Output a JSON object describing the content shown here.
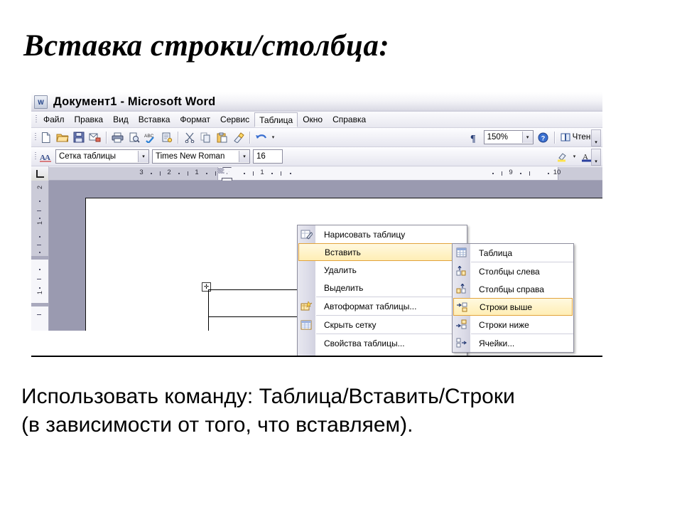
{
  "slide": {
    "title": "Вставка строки/столбца:",
    "caption_line1": "Использовать команду:  Таблица/Вставить/Строки",
    "caption_line2": "(в зависимости от того, что вставляем)."
  },
  "word": {
    "titlebar": {
      "text": "Документ1 - Microsoft Word",
      "app_icon": "word-document-icon",
      "icon_letter": "W"
    },
    "menubar": [
      {
        "label": "Файл",
        "accel": "Ф",
        "active": false
      },
      {
        "label": "Правка",
        "accel": "П",
        "active": false
      },
      {
        "label": "Вид",
        "accel": "В",
        "active": false
      },
      {
        "label": "Вставка",
        "accel": "а",
        "active": false
      },
      {
        "label": "Формат",
        "accel": "м",
        "active": false
      },
      {
        "label": "Сервис",
        "accel": "е",
        "active": false
      },
      {
        "label": "Таблица",
        "accel": "Т",
        "active": true
      },
      {
        "label": "Окно",
        "accel": "О",
        "active": false
      },
      {
        "label": "Справка",
        "accel": "С",
        "active": false
      }
    ],
    "standard_toolbar": {
      "buttons": [
        "new-document-icon",
        "open-folder-icon",
        "save-disk-icon",
        "email-icon",
        "print-icon",
        "print-preview-icon",
        "spelling-check-icon",
        "research-icon",
        "cut-scissors-icon",
        "copy-icon",
        "paste-clipboard-icon",
        "format-painter-icon",
        "undo-arrow-icon"
      ],
      "paragraph_marks_icon": "pilcrow-icon",
      "zoom_value": "150%",
      "help_icon": "help-question-icon",
      "reading_label": "Чтение",
      "reading_icon": "book-reading-icon",
      "overflow_icon": "toolbar-options-icon"
    },
    "formatting_toolbar": {
      "styles_icon": "styles-and-formatting-icon",
      "style_value": "Сетка таблицы",
      "font_value": "Times New Roman",
      "size_value": "16",
      "highlight_icon": "highlight-color-icon",
      "fontcolor_icon": "font-color-icon",
      "overflow_icon": "toolbar-options-icon"
    },
    "ruler": {
      "tab_stop_icon": "left-tab-stop-icon",
      "left_numbers": [
        "3",
        "2",
        "1"
      ],
      "right_numbers": [
        "1",
        "9",
        "10"
      ]
    },
    "vertical_ruler": {
      "numbers": [
        "2",
        "1",
        "1"
      ]
    },
    "document": {
      "table": {
        "rows": 2,
        "columns": 3,
        "cells": [
          [
            "",
            "",
            ""
          ],
          [
            "",
            "",
            ""
          ]
        ]
      },
      "move_handle_icon": "table-move-handle-icon",
      "resize_handle_icon": "table-resize-handle-icon"
    },
    "menu_table": {
      "items": [
        {
          "label": "Нарисовать таблицу",
          "accel": "Н",
          "icon": "draw-table-icon",
          "submenu": false,
          "selected": false,
          "sep_after": false
        },
        {
          "label": "Вставить",
          "accel": "а",
          "icon": "",
          "submenu": true,
          "selected": true,
          "sep_after": false
        },
        {
          "label": "Удалить",
          "accel": "д",
          "icon": "",
          "submenu": true,
          "selected": false,
          "sep_after": false
        },
        {
          "label": "Выделить",
          "accel": "ы",
          "icon": "",
          "submenu": true,
          "selected": false,
          "sep_after": true
        },
        {
          "label": "Автоформат таблицы...",
          "accel": "м",
          "icon": "autoformat-table-icon",
          "submenu": false,
          "selected": false,
          "sep_after": true
        },
        {
          "label": "Скрыть сетку",
          "accel": "е",
          "icon": "hide-gridlines-icon",
          "submenu": false,
          "selected": false,
          "sep_after": true
        },
        {
          "label": "Свойства таблицы...",
          "accel": "С",
          "icon": "",
          "submenu": false,
          "selected": false,
          "sep_after": false
        }
      ],
      "expand_icon": "chevron-double-down-icon"
    },
    "menu_insert": {
      "items": [
        {
          "label": "Таблица",
          "accel": "Т",
          "icon": "insert-table-icon",
          "selected": false,
          "sep_after": true
        },
        {
          "label": "Столбцы слева",
          "accel": "е",
          "icon": "insert-columns-left-icon",
          "selected": false,
          "sep_after": false
        },
        {
          "label": "Столбцы справа",
          "accel": "р",
          "icon": "insert-columns-right-icon",
          "selected": false,
          "sep_after": false
        },
        {
          "label": "Строки выше",
          "accel": "в",
          "icon": "insert-rows-above-icon",
          "selected": true,
          "sep_after": false
        },
        {
          "label": "Строки ниже",
          "accel": "н",
          "icon": "insert-rows-below-icon",
          "selected": false,
          "sep_after": true
        },
        {
          "label": "Ячейки...",
          "accel": "Я",
          "icon": "insert-cells-icon",
          "selected": false,
          "sep_after": false
        }
      ]
    },
    "colors": {
      "menu_highlight_fill": "#ffeeb5",
      "menu_highlight_border": "#e2a33c",
      "toolbar_face": "#e6e6ef",
      "canvas_gray": "#9a9ab0",
      "ruler_gray": "#cbcbd8"
    }
  }
}
